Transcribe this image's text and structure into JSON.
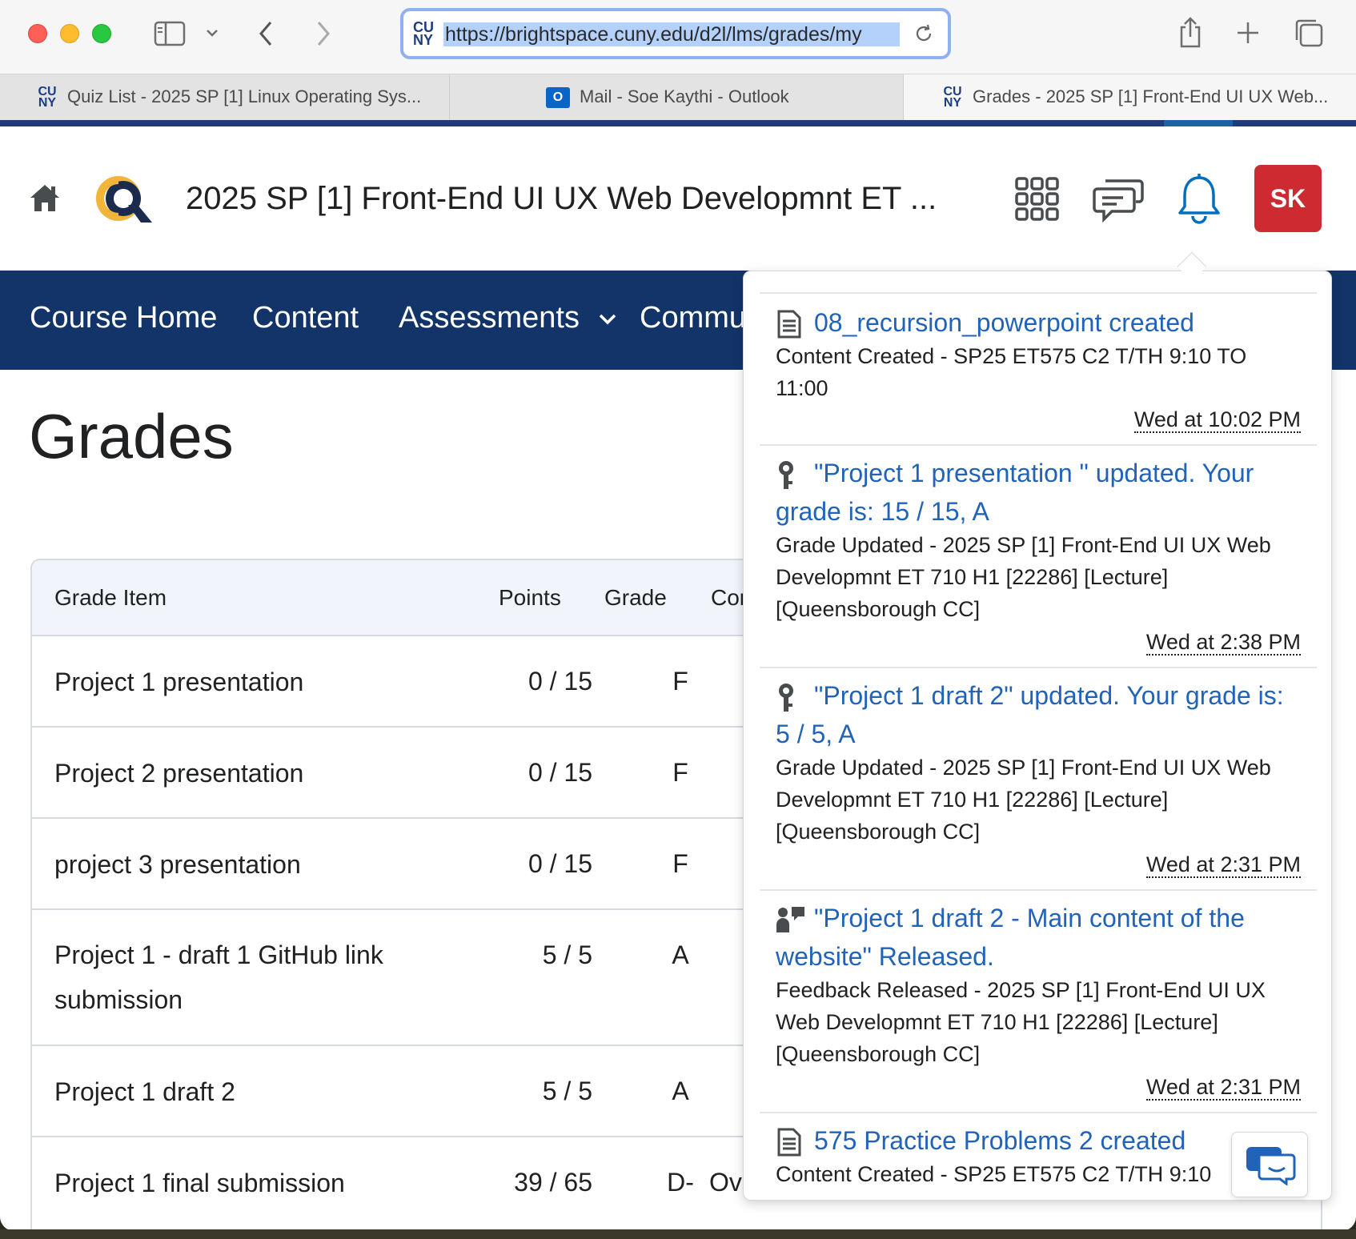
{
  "browser": {
    "url": "https://brightspace.cuny.edu/d2l/lms/grades/my",
    "url_logo": "CU NY",
    "tabs": [
      {
        "label": "Quiz List - 2025 SP [1] Linux Operating Sys...",
        "active": false
      },
      {
        "label": "Mail - Soe Kaythi - Outlook",
        "active": false
      },
      {
        "label": "Grades - 2025 SP [1] Front-End UI UX Web...",
        "active": true
      }
    ]
  },
  "header": {
    "course_title": "2025 SP [1] Front-End UI UX Web Developmnt ET ...",
    "avatar_initials": "SK",
    "avatar_color": "#cd2b31"
  },
  "nav": {
    "items": [
      "Course Home",
      "Content",
      "Assessments",
      "Commu"
    ]
  },
  "page": {
    "title": "Grades"
  },
  "grades_table": {
    "columns": [
      "Grade Item",
      "Points",
      "Grade",
      "Cor"
    ],
    "rows": [
      {
        "item": "Project 1 presentation",
        "points": "0 / 15",
        "grade": "F",
        "comments": ""
      },
      {
        "item": "Project 2 presentation",
        "points": "0 / 15",
        "grade": "F",
        "comments": ""
      },
      {
        "item": "project 3 presentation",
        "points": "0 / 15",
        "grade": "F",
        "comments": ""
      },
      {
        "item": "Project 1 - draft 1 GitHub link submission",
        "points": "5 / 5",
        "grade": "A",
        "comments": ""
      },
      {
        "item": "Project 1 draft 2",
        "points": "5 / 5",
        "grade": "A",
        "comments": ""
      },
      {
        "item": "Project 1 final submission",
        "points": "39 / 65",
        "grade": "D-",
        "comments": "Ov"
      }
    ]
  },
  "notifications": [
    {
      "icon": "document-icon",
      "title": "08_recursion_powerpoint created",
      "desc": "Content Created - SP25 ET575 C2 T/TH 9:10 TO 11:00",
      "time": "Wed at 10:02 PM"
    },
    {
      "icon": "award-ribbon-icon",
      "title": "\"Project 1 presentation \" updated. Your grade is: 15 / 15, A",
      "desc": "Grade Updated - 2025 SP [1] Front-End UI UX Web Developmnt ET 710 H1 [22286] [Lecture] [Queensborough CC]",
      "time": "Wed at 2:38 PM"
    },
    {
      "icon": "award-ribbon-icon",
      "title": "\"Project 1 draft 2\" updated. Your grade is: 5 / 5, A",
      "desc": "Grade Updated - 2025 SP [1] Front-End UI UX Web Developmnt ET 710 H1 [22286] [Lecture] [Queensborough CC]",
      "time": "Wed at 2:31 PM"
    },
    {
      "icon": "feedback-icon",
      "title": "\"Project 1 draft 2 - Main content of the website\" Released.",
      "desc": "Feedback Released - 2025 SP [1] Front-End UI UX Web Developmnt ET 710 H1 [22286] [Lecture] [Queensborough CC]",
      "time": "Wed at 2:31 PM"
    },
    {
      "icon": "document-icon",
      "title": "575 Practice Problems 2 created",
      "desc": "Content Created - SP25 ET575 C2 T/TH 9:10",
      "time": ""
    }
  ],
  "colors": {
    "nav_bg": "#133469",
    "link_blue": "#2063b9",
    "logo_gold": "#f2b53c"
  }
}
